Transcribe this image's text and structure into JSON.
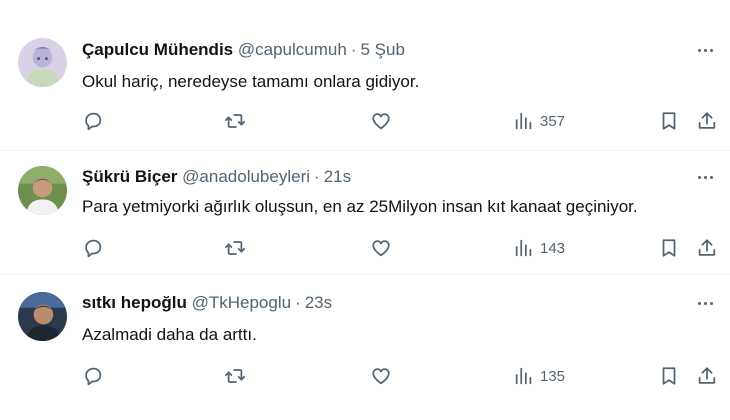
{
  "tweets": [
    {
      "name": "Çapulcu Mühendis",
      "handle": "@capulcumuh",
      "separator": "·",
      "time": "5 Şub",
      "text": "Okul hariç, neredeyse tamamı onlara gidiyor.",
      "views": "357"
    },
    {
      "name": "Şükrü Biçer",
      "handle": "@anadolubeyleri",
      "separator": "·",
      "time": "21s",
      "text": "Para yetmiyorki ağırlık oluşsun, en az 25Milyon insan kıt kanaat geçiniyor.",
      "views": "143"
    },
    {
      "name": "sıtkı hepoğlu",
      "handle": "@TkHepoglu",
      "separator": "·",
      "time": "23s",
      "text": "Azalmadi daha da arttı.",
      "views": "135"
    }
  ],
  "icons": {
    "reply": "reply-icon",
    "retweet": "retweet-icon",
    "like": "heart-icon",
    "views": "views-chart-icon",
    "bookmark": "bookmark-icon",
    "share": "share-icon",
    "more": "more-options-icon"
  },
  "colors": {
    "text": "#0f1419",
    "secondary": "#536471",
    "divider": "#eff3f4"
  }
}
